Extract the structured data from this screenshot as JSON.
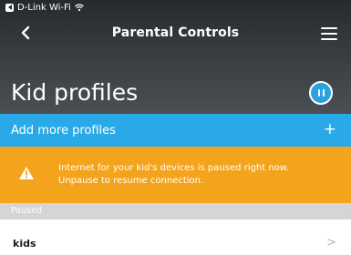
{
  "status": {
    "network": "D-Link Wi-Fi"
  },
  "nav": {
    "title": "Parental Controls"
  },
  "header": {
    "title": "Kid profiles"
  },
  "add_bar": {
    "label": "Add more profiles",
    "plus": "+"
  },
  "warning": {
    "line1": "Internet for your kid's devices is paused right now.",
    "line2": "Unpause to resume connection."
  },
  "section": {
    "label": "Paused"
  },
  "profiles": [
    {
      "name": "kids",
      "chevron": ">"
    }
  ],
  "colors": {
    "accent_blue": "#29a9e8",
    "warning_orange": "#f4a31c",
    "header_dark": "#3b4044",
    "section_gray": "#d5d5d5"
  }
}
